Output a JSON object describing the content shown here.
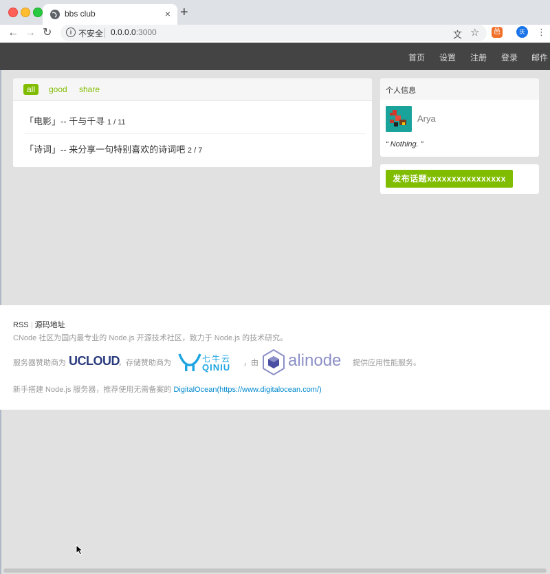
{
  "browser": {
    "tab_title": "bbs club",
    "tab_close": "×",
    "new_tab": "+",
    "back": "←",
    "forward": "→",
    "reload": "↻",
    "security_label": "不安全",
    "url_host": "0.0.0.0",
    "url_port": ":3000",
    "extension_label": "邑",
    "profile_label": "庆",
    "menu": "⋮",
    "translate_icon": "文",
    "star_icon": "☆"
  },
  "navbar": {
    "items": [
      "首页",
      "设置",
      "注册",
      "登录",
      "邮件"
    ]
  },
  "topics": {
    "tabs": [
      "all",
      "good",
      "share"
    ],
    "rows": [
      {
        "title": "「电影」-- 千与千寻",
        "count": "1 / 11"
      },
      {
        "title": "「诗词」-- 来分享一句特别喜欢的诗词吧",
        "count": "2 / 7"
      }
    ]
  },
  "sidebar": {
    "user_header": "个人信息",
    "username": "Arya",
    "signature": "“ Nothing. ”",
    "post_button": "发布话题xxxxxxxxxxxxxxxx"
  },
  "footer": {
    "rss": "RSS",
    "source": "源码地址",
    "description": "CNode 社区为国内最专业的 Node.js 开源技术社区，致力于 Node.js 的技术研究。",
    "sponsor_prefix": "服务器赞助商为",
    "ucloud": "UCLOUD",
    "storage_prefix": "，存储赞助商为",
    "qiniu_cn": "七牛云",
    "qiniu_en": "QINIU",
    "by": "，由",
    "alinode": "alinode",
    "perf_suffix": "提供应用性能服务。",
    "ocean_prefix": "新手搭建 Node.js 服务器，推荐使用无需备案的",
    "ocean_link": "DigitalOcean(https://www.digitalocean.com/)"
  }
}
